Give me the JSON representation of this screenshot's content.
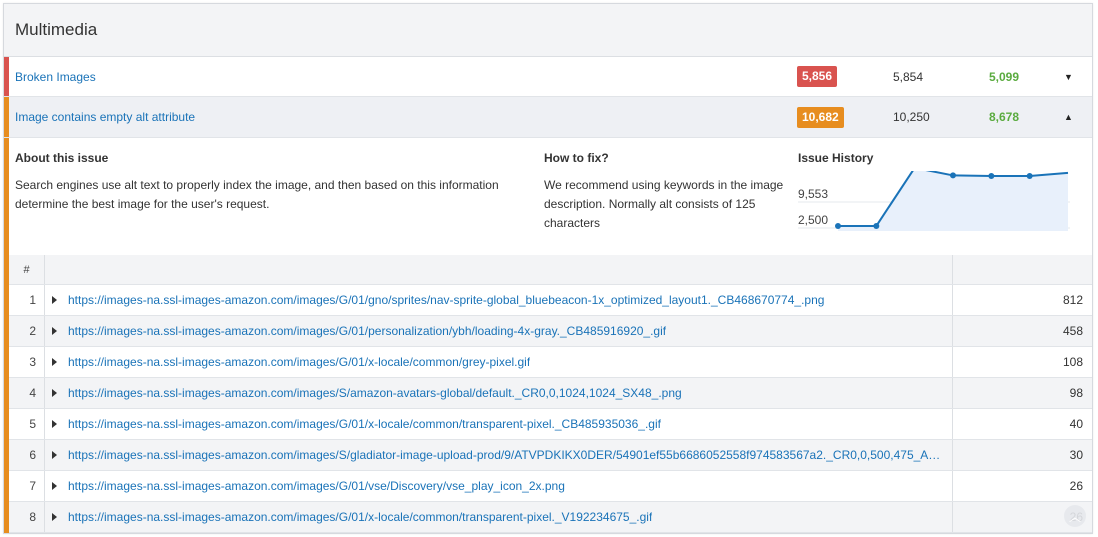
{
  "panel": {
    "title": "Multimedia"
  },
  "issues": {
    "broken": {
      "label": "Broken Images",
      "badge": "5,856",
      "total": "5,854",
      "fixed": "5,099",
      "badge_color": "#d9534f",
      "accent_color": "#d9534f",
      "toggle_icon": "caret-down-icon"
    },
    "alt": {
      "label": "Image contains empty alt attribute",
      "badge": "10,682",
      "total": "10,250",
      "fixed": "8,678",
      "badge_color": "#e78d1f",
      "accent_color": "#e78d1f",
      "toggle_icon": "caret-up-icon"
    }
  },
  "details": {
    "about_title": "About this issue",
    "about_text": "Search engines use alt text to properly index the image, and then based on this information determine the best image for the user's request.",
    "fix_title": "How to fix?",
    "fix_text": "We recommend using keywords in the image description. Normally alt consists of 125 characters",
    "history_title": "Issue History",
    "history_ticks": [
      "9,553",
      "2,500"
    ]
  },
  "chart_data": {
    "type": "area",
    "title": "Issue History",
    "yticks": [
      "9,553",
      "2,500"
    ],
    "values": [
      2300,
      2300,
      11500,
      10300,
      10200,
      10200,
      10700
    ],
    "ylim": [
      1500,
      11000
    ],
    "line_color": "#1a73b8",
    "fill_color": "#e8f0fb"
  },
  "table": {
    "header_num": "#",
    "rows": [
      {
        "num": "1",
        "url": "https://images-na.ssl-images-amazon.com/images/G/01/gno/sprites/nav-sprite-global_bluebeacon-1x_optimized_layout1._CB468670774_.png",
        "count": "812"
      },
      {
        "num": "2",
        "url": "https://images-na.ssl-images-amazon.com/images/G/01/personalization/ybh/loading-4x-gray._CB485916920_.gif",
        "count": "458"
      },
      {
        "num": "3",
        "url": "https://images-na.ssl-images-amazon.com/images/G/01/x-locale/common/grey-pixel.gif",
        "count": "108"
      },
      {
        "num": "4",
        "url": "https://images-na.ssl-images-amazon.com/images/S/amazon-avatars-global/default._CR0,0,1024,1024_SX48_.png",
        "count": "98"
      },
      {
        "num": "5",
        "url": "https://images-na.ssl-images-amazon.com/images/G/01/x-locale/common/transparent-pixel._CB485935036_.gif",
        "count": "40"
      },
      {
        "num": "6",
        "url": "https://images-na.ssl-images-amazon.com/images/S/gladiator-image-upload-prod/9/ATVPDKIKX0DER/54901ef55b6686052558f974583567a2._CR0,0,500,475_A…",
        "count": "30"
      },
      {
        "num": "7",
        "url": "https://images-na.ssl-images-amazon.com/images/G/01/vse/Discovery/vse_play_icon_2x.png",
        "count": "26"
      },
      {
        "num": "8",
        "url": "https://images-na.ssl-images-amazon.com/images/G/01/x-locale/common/transparent-pixel._V192234675_.gif",
        "count": "26"
      }
    ]
  }
}
